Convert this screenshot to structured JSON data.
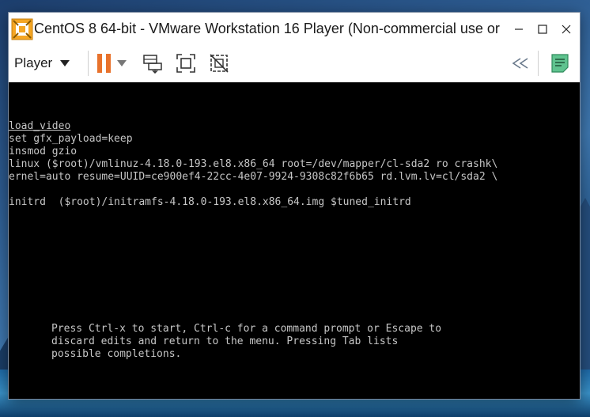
{
  "window": {
    "title": "CentOS 8 64-bit - VMware Workstation 16 Player (Non-commercial use or",
    "logo_icon": "vmware-logo-icon",
    "minimize_icon": "minimize-icon",
    "maximize_icon": "maximize-icon",
    "close_icon": "close-icon"
  },
  "toolbar": {
    "player_label": "Player",
    "player_dropdown_icon": "caret-down-icon",
    "pause_icon": "pause-icon",
    "pause_dropdown_icon": "caret-down-icon",
    "send_ctrl_alt_del_icon": "send-ctrl-alt-del-icon",
    "fullscreen_icon": "fullscreen-icon",
    "unity_icon": "unity-icon",
    "collapse_icon": "double-chevron-left-icon",
    "notes_icon": "notes-icon",
    "accent_color": "#e8722c",
    "notes_color": "#5fc38f"
  },
  "console": {
    "lines": [
      "load_video",
      "set gfx_payload=keep",
      "insmod gzio",
      "linux ($root)/vmlinuz-4.18.0-193.el8.x86_64 root=/dev/mapper/cl-sda2 ro crashk\\",
      "ernel=auto resume=UUID=ce900ef4-22cc-4e07-9924-9308c82f6b65 rd.lvm.lv=cl/sda2 \\",
      "",
      "initrd  ($root)/initramfs-4.18.0-193.el8.x86_64.img $tuned_initrd"
    ],
    "help": [
      "Press Ctrl-x to start, Ctrl-c for a command prompt or Escape to",
      "discard edits and return to the menu. Pressing Tab lists",
      "possible completions."
    ]
  }
}
